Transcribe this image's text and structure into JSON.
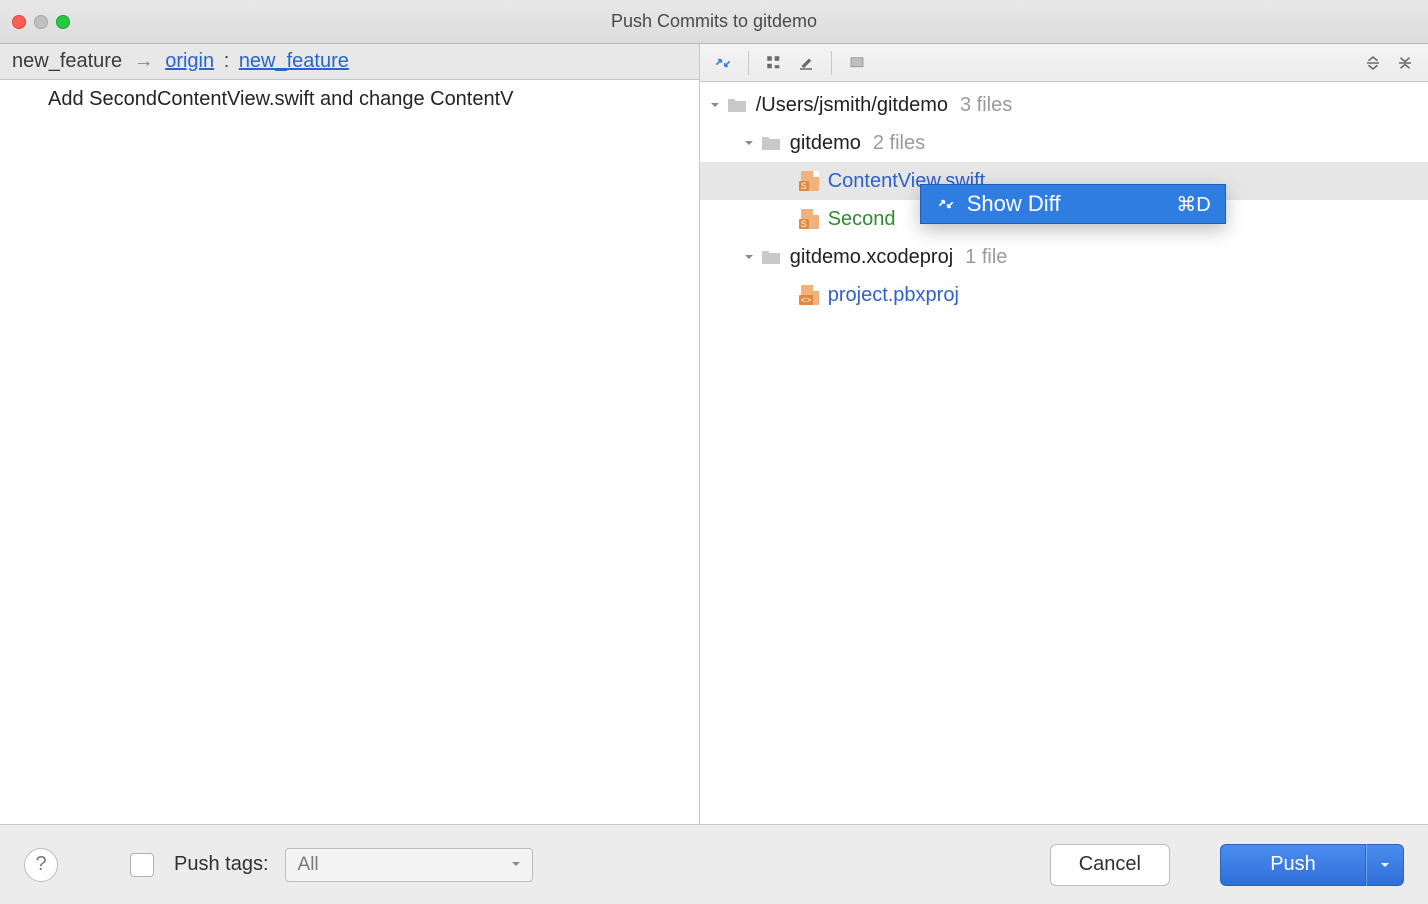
{
  "window": {
    "title": "Push Commits to gitdemo"
  },
  "branchBar": {
    "local": "new_feature",
    "arrow": "→",
    "remote": "origin",
    "colon": ":",
    "target": "new_feature"
  },
  "commitMessage": "Add SecondContentView.swift and change ContentV",
  "tree": {
    "root": {
      "label": "/Users/jsmith/gitdemo",
      "count": "3 files"
    },
    "folder1": {
      "label": "gitdemo",
      "count": "2 files",
      "files": [
        {
          "label": "ContentView.swift",
          "color": "blue",
          "iconTag": "S"
        },
        {
          "label": "Second",
          "color": "green",
          "iconTag": "S"
        }
      ]
    },
    "folder2": {
      "label": "gitdemo.xcodeproj",
      "count": "1 file",
      "files": [
        {
          "label": "project.pbxproj",
          "color": "blue",
          "iconTag": "<>"
        }
      ]
    }
  },
  "contextMenu": {
    "items": [
      {
        "label": "Show Diff",
        "shortcut": "⌘D"
      }
    ]
  },
  "bottomBar": {
    "pushTagsLabel": "Push tags:",
    "selectValue": "All",
    "cancelLabel": "Cancel",
    "pushLabel": "Push"
  }
}
